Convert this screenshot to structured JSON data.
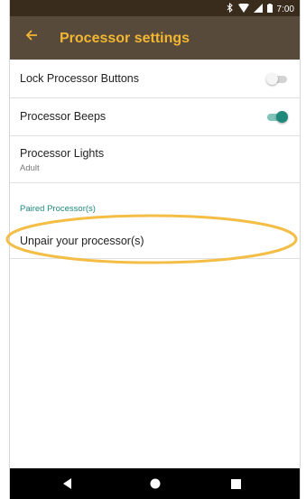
{
  "status_bar": {
    "time": "7:00"
  },
  "app_bar": {
    "title": "Processor settings"
  },
  "settings": {
    "lock_buttons": {
      "label": "Lock Processor Buttons",
      "enabled": false
    },
    "beeps": {
      "label": "Processor Beeps",
      "enabled": true
    },
    "lights": {
      "label": "Processor Lights",
      "value": "Adult"
    }
  },
  "paired_section": {
    "header": "Paired Processor(s)",
    "unpair_label": "Unpair your processor(s)"
  },
  "colors": {
    "accent": "#f2b632",
    "teal": "#1f8a7c",
    "app_bar": "#574a3a",
    "highlight": "#f4bd45"
  },
  "icons": {
    "back": "arrow-left-icon",
    "bluetooth": "bluetooth-icon",
    "wifi": "wifi-icon",
    "signal": "signal-icon",
    "battery": "battery-icon",
    "nav_back": "triangle-back-icon",
    "nav_home": "circle-home-icon",
    "nav_recent": "square-recents-icon"
  }
}
